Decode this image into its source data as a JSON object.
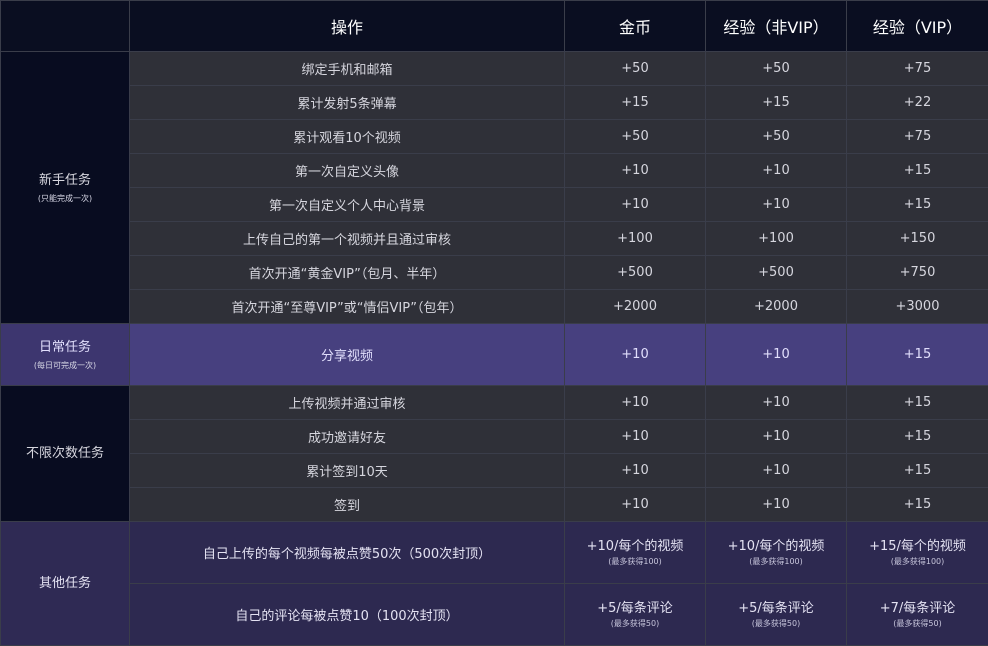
{
  "header": {
    "action": "操作",
    "coin": "金币",
    "exp_nonvip": "经验（非VIP）",
    "exp_vip": "经验（VIP）"
  },
  "novice": {
    "title": "新手任务",
    "subtitle": "(只能完成一次)",
    "rows": [
      {
        "action": "绑定手机和邮箱",
        "coin": "+50",
        "exp_nonvip": "+50",
        "exp_vip": "+75"
      },
      {
        "action": "累计发射5条弹幕",
        "coin": "+15",
        "exp_nonvip": "+15",
        "exp_vip": "+22"
      },
      {
        "action": "累计观看10个视频",
        "coin": "+50",
        "exp_nonvip": "+50",
        "exp_vip": "+75"
      },
      {
        "action": "第一次自定义头像",
        "coin": "+10",
        "exp_nonvip": "+10",
        "exp_vip": "+15"
      },
      {
        "action": "第一次自定义个人中心背景",
        "coin": "+10",
        "exp_nonvip": "+10",
        "exp_vip": "+15"
      },
      {
        "action": "上传自己的第一个视频并且通过审核",
        "coin": "+100",
        "exp_nonvip": "+100",
        "exp_vip": "+150"
      },
      {
        "action": "首次开通“黄金VIP”（包月、半年）",
        "coin": "+500",
        "exp_nonvip": "+500",
        "exp_vip": "+750"
      },
      {
        "action": "首次开通“至尊VIP”或“情侣VIP”（包年）",
        "coin": "+2000",
        "exp_nonvip": "+2000",
        "exp_vip": "+3000"
      }
    ]
  },
  "daily": {
    "title": "日常任务",
    "subtitle": "(每日可完成一次)",
    "rows": [
      {
        "action": "分享视频",
        "coin": "+10",
        "exp_nonvip": "+10",
        "exp_vip": "+15"
      }
    ]
  },
  "unlimited": {
    "title": "不限次数任务",
    "rows": [
      {
        "action": "上传视频并通过审核",
        "coin": "+10",
        "exp_nonvip": "+10",
        "exp_vip": "+15"
      },
      {
        "action": "成功邀请好友",
        "coin": "+10",
        "exp_nonvip": "+10",
        "exp_vip": "+15"
      },
      {
        "action": "累计签到10天",
        "coin": "+10",
        "exp_nonvip": "+10",
        "exp_vip": "+15"
      },
      {
        "action": "签到",
        "coin": "+10",
        "exp_nonvip": "+10",
        "exp_vip": "+15"
      }
    ]
  },
  "other": {
    "title": "其他任务",
    "rows": [
      {
        "action": "自己上传的每个视频每被点赞50次（500次封顶）",
        "coin": "+10/每个的视频",
        "coin_note": "(最多获得100)",
        "exp_nonvip": "+10/每个的视频",
        "exp_nonvip_note": "(最多获得100)",
        "exp_vip": "+15/每个的视频",
        "exp_vip_note": "(最多获得100)"
      },
      {
        "action": "自己的评论每被点赞10（100次封顶）",
        "coin": "+5/每条评论",
        "coin_note": "(最多获得50)",
        "exp_nonvip": "+5/每条评论",
        "exp_nonvip_note": "(最多获得50)",
        "exp_vip": "+7/每条评论",
        "exp_vip_note": "(最多获得50)"
      }
    ]
  }
}
